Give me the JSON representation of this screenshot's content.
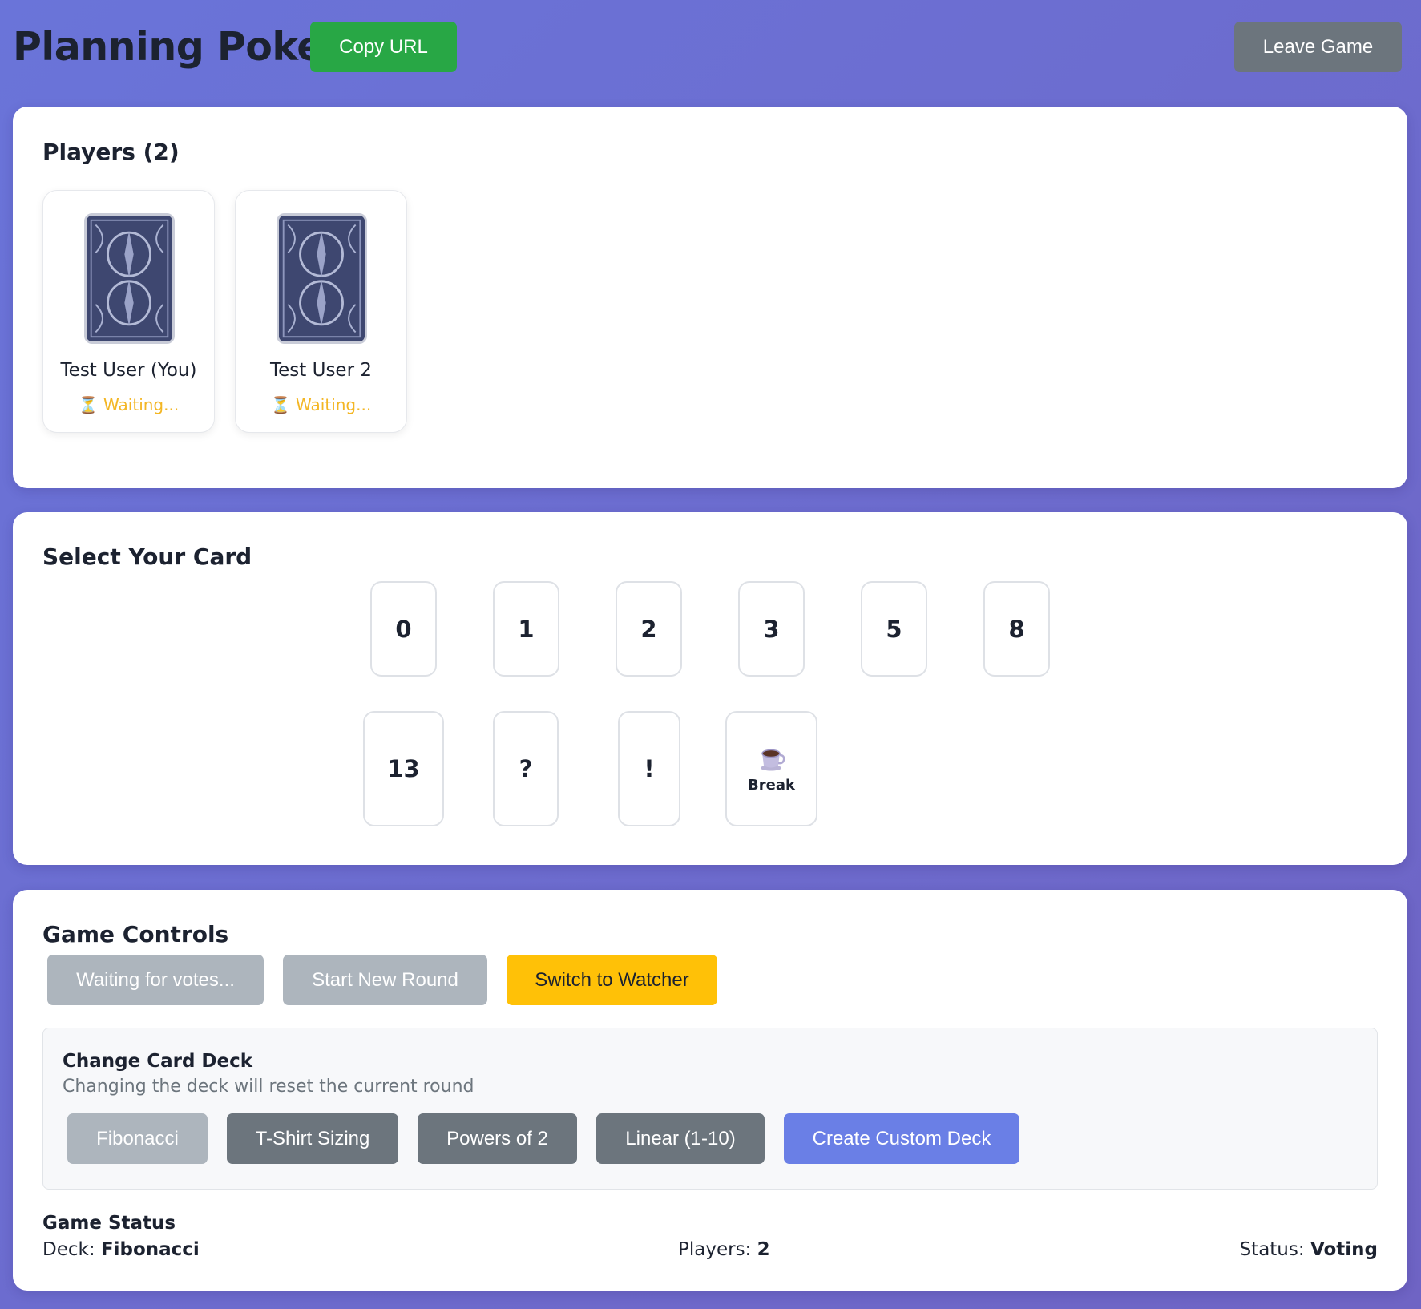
{
  "header": {
    "title": "Planning Poker",
    "copy_url_label": "Copy URL",
    "leave_game_label": "Leave Game"
  },
  "players_panel": {
    "heading": "Players (2)",
    "players": [
      {
        "name": "Test User (You)",
        "status_icon": "hourglass-icon",
        "status": "⏳ Waiting..."
      },
      {
        "name": "Test User 2",
        "status_icon": "hourglass-icon",
        "status": "⏳ Waiting..."
      }
    ]
  },
  "cards_panel": {
    "heading": "Select Your Card",
    "cards": [
      "0",
      "1",
      "2",
      "3",
      "5",
      "8",
      "13",
      "?",
      "!"
    ],
    "break_card": {
      "icon": "coffee-cup-icon",
      "label": "Break"
    }
  },
  "controls_panel": {
    "heading": "Game Controls",
    "buttons": {
      "reveal": "Waiting for votes...",
      "new_round": "Start New Round",
      "switch_watcher": "Switch to Watcher"
    },
    "deck": {
      "title": "Change Card Deck",
      "subtitle": "Changing the deck will reset the current round",
      "options": [
        "Fibonacci",
        "T-Shirt Sizing",
        "Powers of 2",
        "Linear (1-10)"
      ],
      "custom_label": "Create Custom Deck",
      "selected": "Fibonacci"
    },
    "status": {
      "title": "Game Status",
      "deck_label": "Deck:",
      "deck_value": "Fibonacci",
      "players_label": "Players:",
      "players_value": "2",
      "status_label": "Status:",
      "status_value": "Voting"
    }
  },
  "colors": {
    "background_start": "#6a74d9",
    "background_end": "#6f64c4",
    "success": "#28a745",
    "secondary": "#6c757d",
    "disabled": "#adb5bd",
    "warning": "#ffc107",
    "primary": "#6a7fe6"
  }
}
